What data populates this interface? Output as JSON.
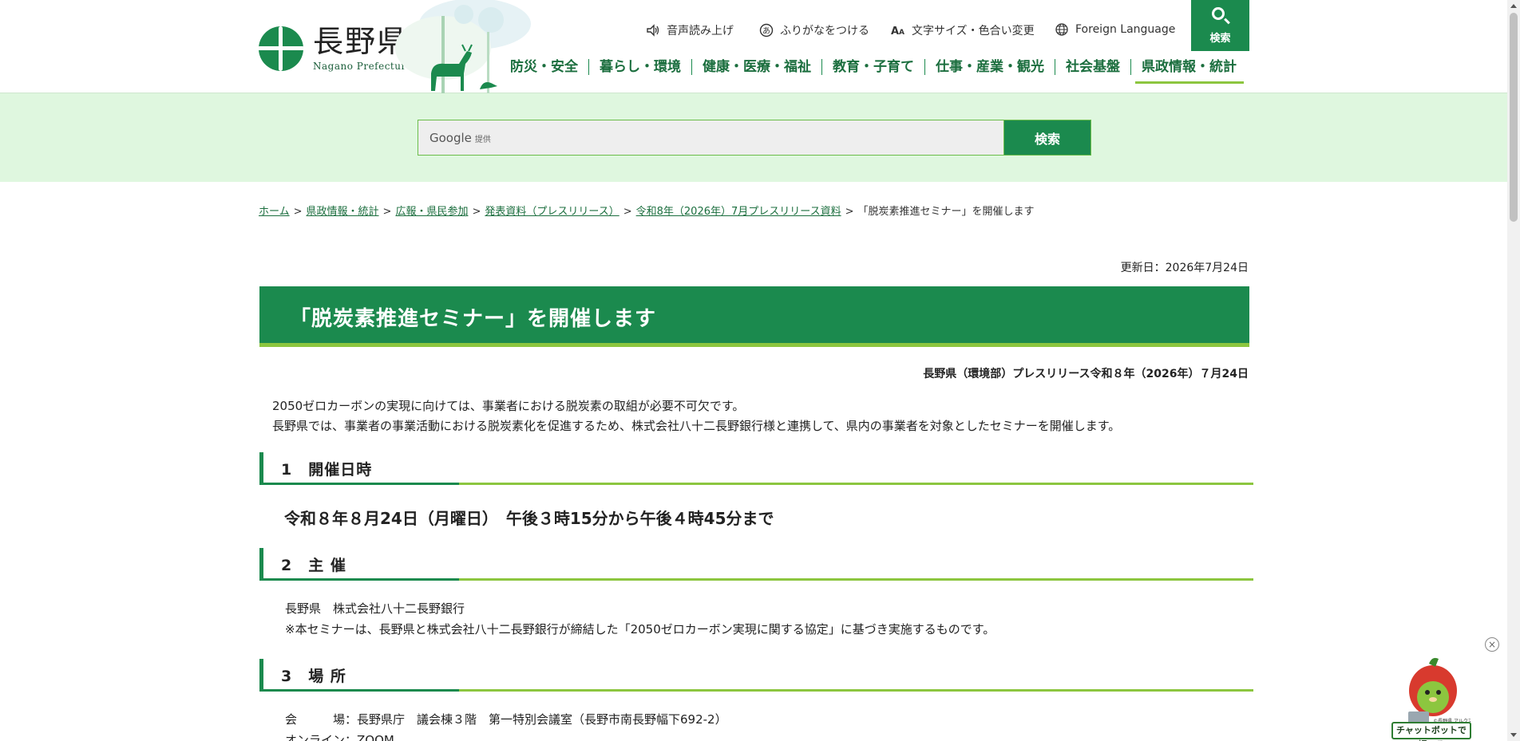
{
  "header": {
    "logo_jp": "長野県",
    "logo_en": "Nagano Prefecture",
    "utilities": [
      {
        "label": "音声読み上げ",
        "icon": "speaker-icon"
      },
      {
        "label": "ふりがなをつける",
        "icon": "hiragana-icon"
      },
      {
        "label": "文字サイズ・色合い変更",
        "icon": "text-size-icon"
      },
      {
        "label": "Foreign Language",
        "icon": "globe-icon"
      }
    ],
    "search_button_label": "検索",
    "nav": [
      "防災・安全",
      "暮らし・環境",
      "健康・医療・福祉",
      "教育・子育て",
      "仕事・産業・観光",
      "社会基盤",
      "県政情報・統計"
    ]
  },
  "search": {
    "provider": "Google",
    "provider_note": "提供",
    "button_label": "検索"
  },
  "breadcrumb": {
    "links": [
      "ホーム",
      "県政情報・統計",
      "広報・県民参加",
      "発表資料（プレスリリース）",
      "令和8年（2026年）7月プレスリリース資料"
    ],
    "current": "「脱炭素推進セミナー」を開催します",
    "separator": ">"
  },
  "page": {
    "updated": "更新日：2026年7月24日",
    "title": "「脱炭素推進セミナー」を開催します",
    "press_line": "長野県（環境部）プレスリリース令和８年（2026年）７月24日",
    "intro_1": "2050ゼロカーボンの実現に向けては、事業者における脱炭素の取組が必要不可欠です。",
    "intro_2": "長野県では、事業者の事業活動における脱炭素化を促進するため、株式会社八十二長野銀行様と連携して、県内の事業者を対象としたセミナーを開催します。",
    "sections": [
      {
        "heading": "1　開催日時",
        "lines": [
          "令和８年８月24日（月曜日）　午後３時15分から午後４時45分まで"
        ]
      },
      {
        "heading": "2　主 催",
        "lines": [
          "長野県　株式会社八十二長野銀行",
          "※本セミナーは、長野県と株式会社八十二長野銀行が締結した「2050ゼロカーボン実現に関する協定」に基づき実施するものです。"
        ]
      },
      {
        "heading": "3　場 所",
        "lines": [
          "会　　　場：長野県庁　議会棟３階　第一特別会議室（長野市南長野幅下692-2）",
          "オンライン：ZOOM"
        ]
      }
    ]
  },
  "chatbot": {
    "label": "チャットボットで調べる",
    "credit": "©長野県 アルクマ",
    "close": "×"
  },
  "colors": {
    "primary": "#1b8a4e",
    "accent": "#8cc63f",
    "search_band": "#dff7df"
  }
}
